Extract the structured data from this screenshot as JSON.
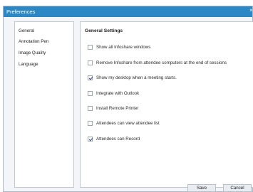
{
  "window": {
    "title": "Preferences",
    "close_glyph": "×"
  },
  "sidebar": {
    "items": [
      {
        "label": "General"
      },
      {
        "label": "Annotation Pen"
      },
      {
        "label": "Image Quality"
      },
      {
        "label": "Language"
      }
    ]
  },
  "panel": {
    "title": "General Settings",
    "options": [
      {
        "label": "Show all Infoshare windows",
        "checked": false
      },
      {
        "label": "Remove Infoshare from attendee computers at the end of sessions",
        "checked": false
      },
      {
        "label": "Show my desktop when a meeting starts.",
        "checked": true
      },
      {
        "label": "Integrate with Outlook",
        "checked": false
      },
      {
        "label": "Install Remote Printer",
        "checked": false
      },
      {
        "label": "Attendees can view attendee list",
        "checked": false
      },
      {
        "label": "Attendees can Record",
        "checked": true
      }
    ]
  },
  "buttons": {
    "save": "Save",
    "cancel": "Cancel"
  },
  "colors": {
    "titlebar": "#2b88c4",
    "panel_bg": "#ffffff",
    "window_bg": "#f3f5f8"
  }
}
